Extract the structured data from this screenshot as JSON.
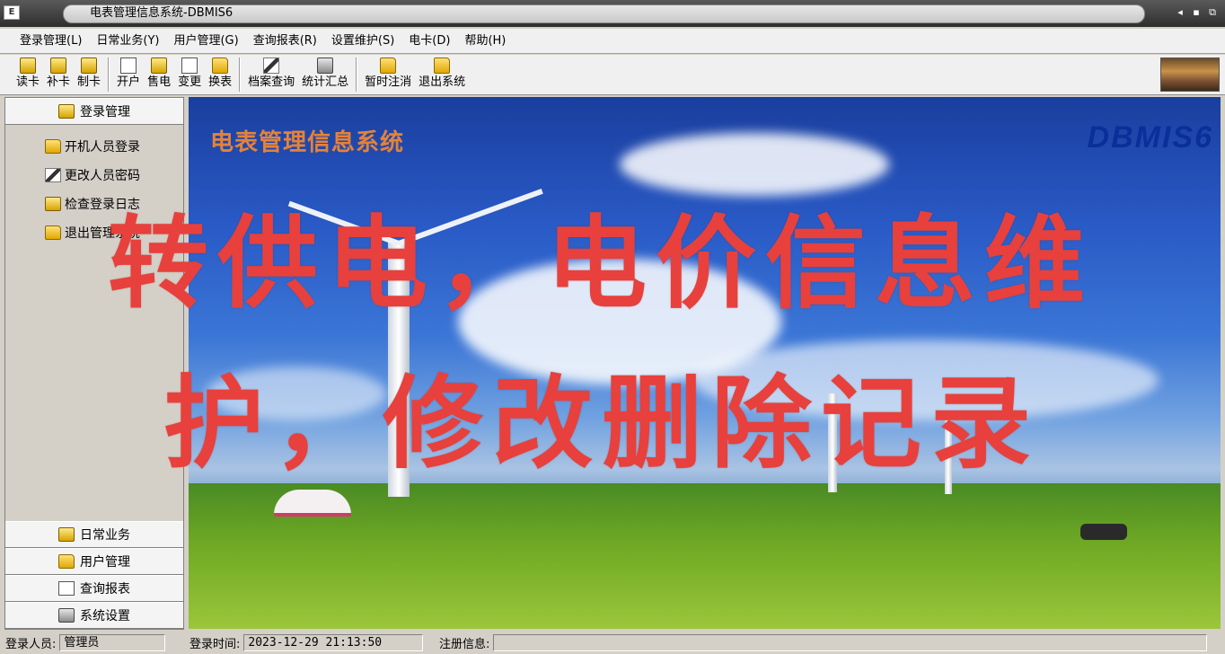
{
  "window": {
    "title": "电表管理信息系统-DBMIS6",
    "controls": [
      "◂",
      "▪",
      "⧉"
    ]
  },
  "menu": [
    "登录管理(L)",
    "日常业务(Y)",
    "用户管理(G)",
    "查询报表(R)",
    "设置维护(S)",
    "电卡(D)",
    "帮助(H)"
  ],
  "toolbar": {
    "groups": [
      [
        {
          "label": "读卡",
          "icon": "card-read-icon"
        },
        {
          "label": "补卡",
          "icon": "card-replace-icon"
        },
        {
          "label": "制卡",
          "icon": "card-make-icon"
        }
      ],
      [
        {
          "label": "开户",
          "icon": "open-account-icon"
        },
        {
          "label": "售电",
          "icon": "sell-power-icon"
        },
        {
          "label": "变更",
          "icon": "change-icon"
        },
        {
          "label": "换表",
          "icon": "swap-meter-icon"
        }
      ],
      [
        {
          "label": "档案查询",
          "icon": "archive-search-icon"
        },
        {
          "label": "统计汇总",
          "icon": "statistics-icon"
        }
      ],
      [
        {
          "label": "暂时注消",
          "icon": "logout-temp-icon"
        },
        {
          "label": "退出系统",
          "icon": "exit-system-icon"
        }
      ]
    ]
  },
  "sidebar": {
    "top_header": "登录管理",
    "items": [
      "开机人员登录",
      "更改人员密码",
      "检查登录日志",
      "退出管理系统"
    ],
    "bottom_headers": [
      "日常业务",
      "用户管理",
      "查询报表",
      "系统设置"
    ]
  },
  "main": {
    "system_title": "电表管理信息系统",
    "brand": "DBMIS6"
  },
  "overlay": {
    "line1": "转供电，电价信息维",
    "line2": "护，修改删除记录"
  },
  "status": {
    "user_label": "登录人员:",
    "user_value": "管理员",
    "time_label": "登录时间:",
    "time_value": "2023-12-29 21:13:50",
    "reg_label": "注册信息:",
    "reg_value": ""
  }
}
